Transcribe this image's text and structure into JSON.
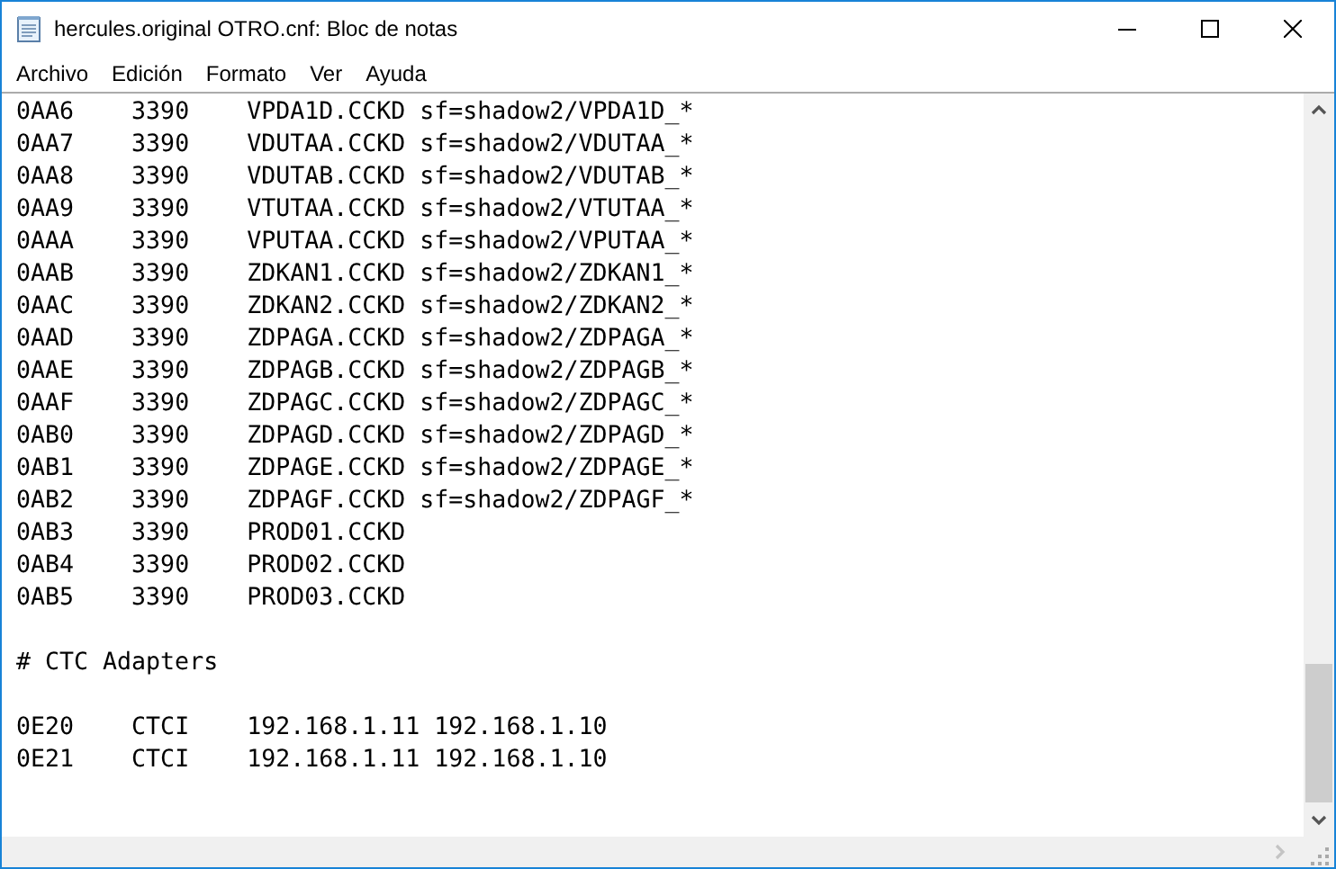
{
  "window": {
    "title": "hercules.original OTRO.cnf: Bloc de notas"
  },
  "menu": [
    "Archivo",
    "Edición",
    "Formato",
    "Ver",
    "Ayuda"
  ],
  "editor": {
    "lines": [
      {
        "kind": "text",
        "text": "0AA6\t3390\tVPDA1D.CCKD sf=shadow2/VPDA1D_*"
      },
      {
        "kind": "text",
        "text": "0AA7\t3390\tVDUTAA.CCKD sf=shadow2/VDUTAA_*"
      },
      {
        "kind": "text",
        "text": "0AA8\t3390\tVDUTAB.CCKD sf=shadow2/VDUTAB_*"
      },
      {
        "kind": "text",
        "text": "0AA9\t3390\tVTUTAA.CCKD sf=shadow2/VTUTAA_*"
      },
      {
        "kind": "text",
        "text": "0AAA\t3390\tVPUTAA.CCKD sf=shadow2/VPUTAA_*"
      },
      {
        "kind": "text",
        "text": "0AAB\t3390\tZDKAN1.CCKD sf=shadow2/ZDKAN1_*"
      },
      {
        "kind": "text",
        "text": "0AAC\t3390\tZDKAN2.CCKD sf=shadow2/ZDKAN2_*"
      },
      {
        "kind": "text",
        "text": "0AAD\t3390\tZDPAGA.CCKD sf=shadow2/ZDPAGA_*"
      },
      {
        "kind": "text",
        "text": "0AAE\t3390\tZDPAGB.CCKD sf=shadow2/ZDPAGB_*"
      },
      {
        "kind": "text",
        "text": "0AAF\t3390\tZDPAGC.CCKD sf=shadow2/ZDPAGC_*"
      },
      {
        "kind": "text",
        "text": "0AB0\t3390\tZDPAGD.CCKD sf=shadow2/ZDPAGD_*"
      },
      {
        "kind": "text",
        "text": "0AB1\t3390\tZDPAGE.CCKD sf=shadow2/ZDPAGE_*"
      },
      {
        "kind": "text",
        "text": "0AB2\t3390\tZDPAGF.CCKD sf=shadow2/ZDPAGF_*"
      },
      {
        "kind": "text",
        "text": "0AB3\t3390\tPROD01.CCKD"
      },
      {
        "kind": "text",
        "text": "0AB4\t3390\tPROD02.CCKD"
      },
      {
        "kind": "text",
        "text": "0AB5\t3390\tPROD03.CCKD"
      },
      {
        "kind": "blank"
      },
      {
        "kind": "text",
        "text": "# CTC Adapters"
      },
      {
        "kind": "blank"
      },
      {
        "kind": "text",
        "text": "0E20\tCTCI\t192.168.1.11 192.168.1.10"
      },
      {
        "kind": "text",
        "text": "0E21\tCTCI\t192.168.1.11 192.168.1.10"
      }
    ]
  }
}
